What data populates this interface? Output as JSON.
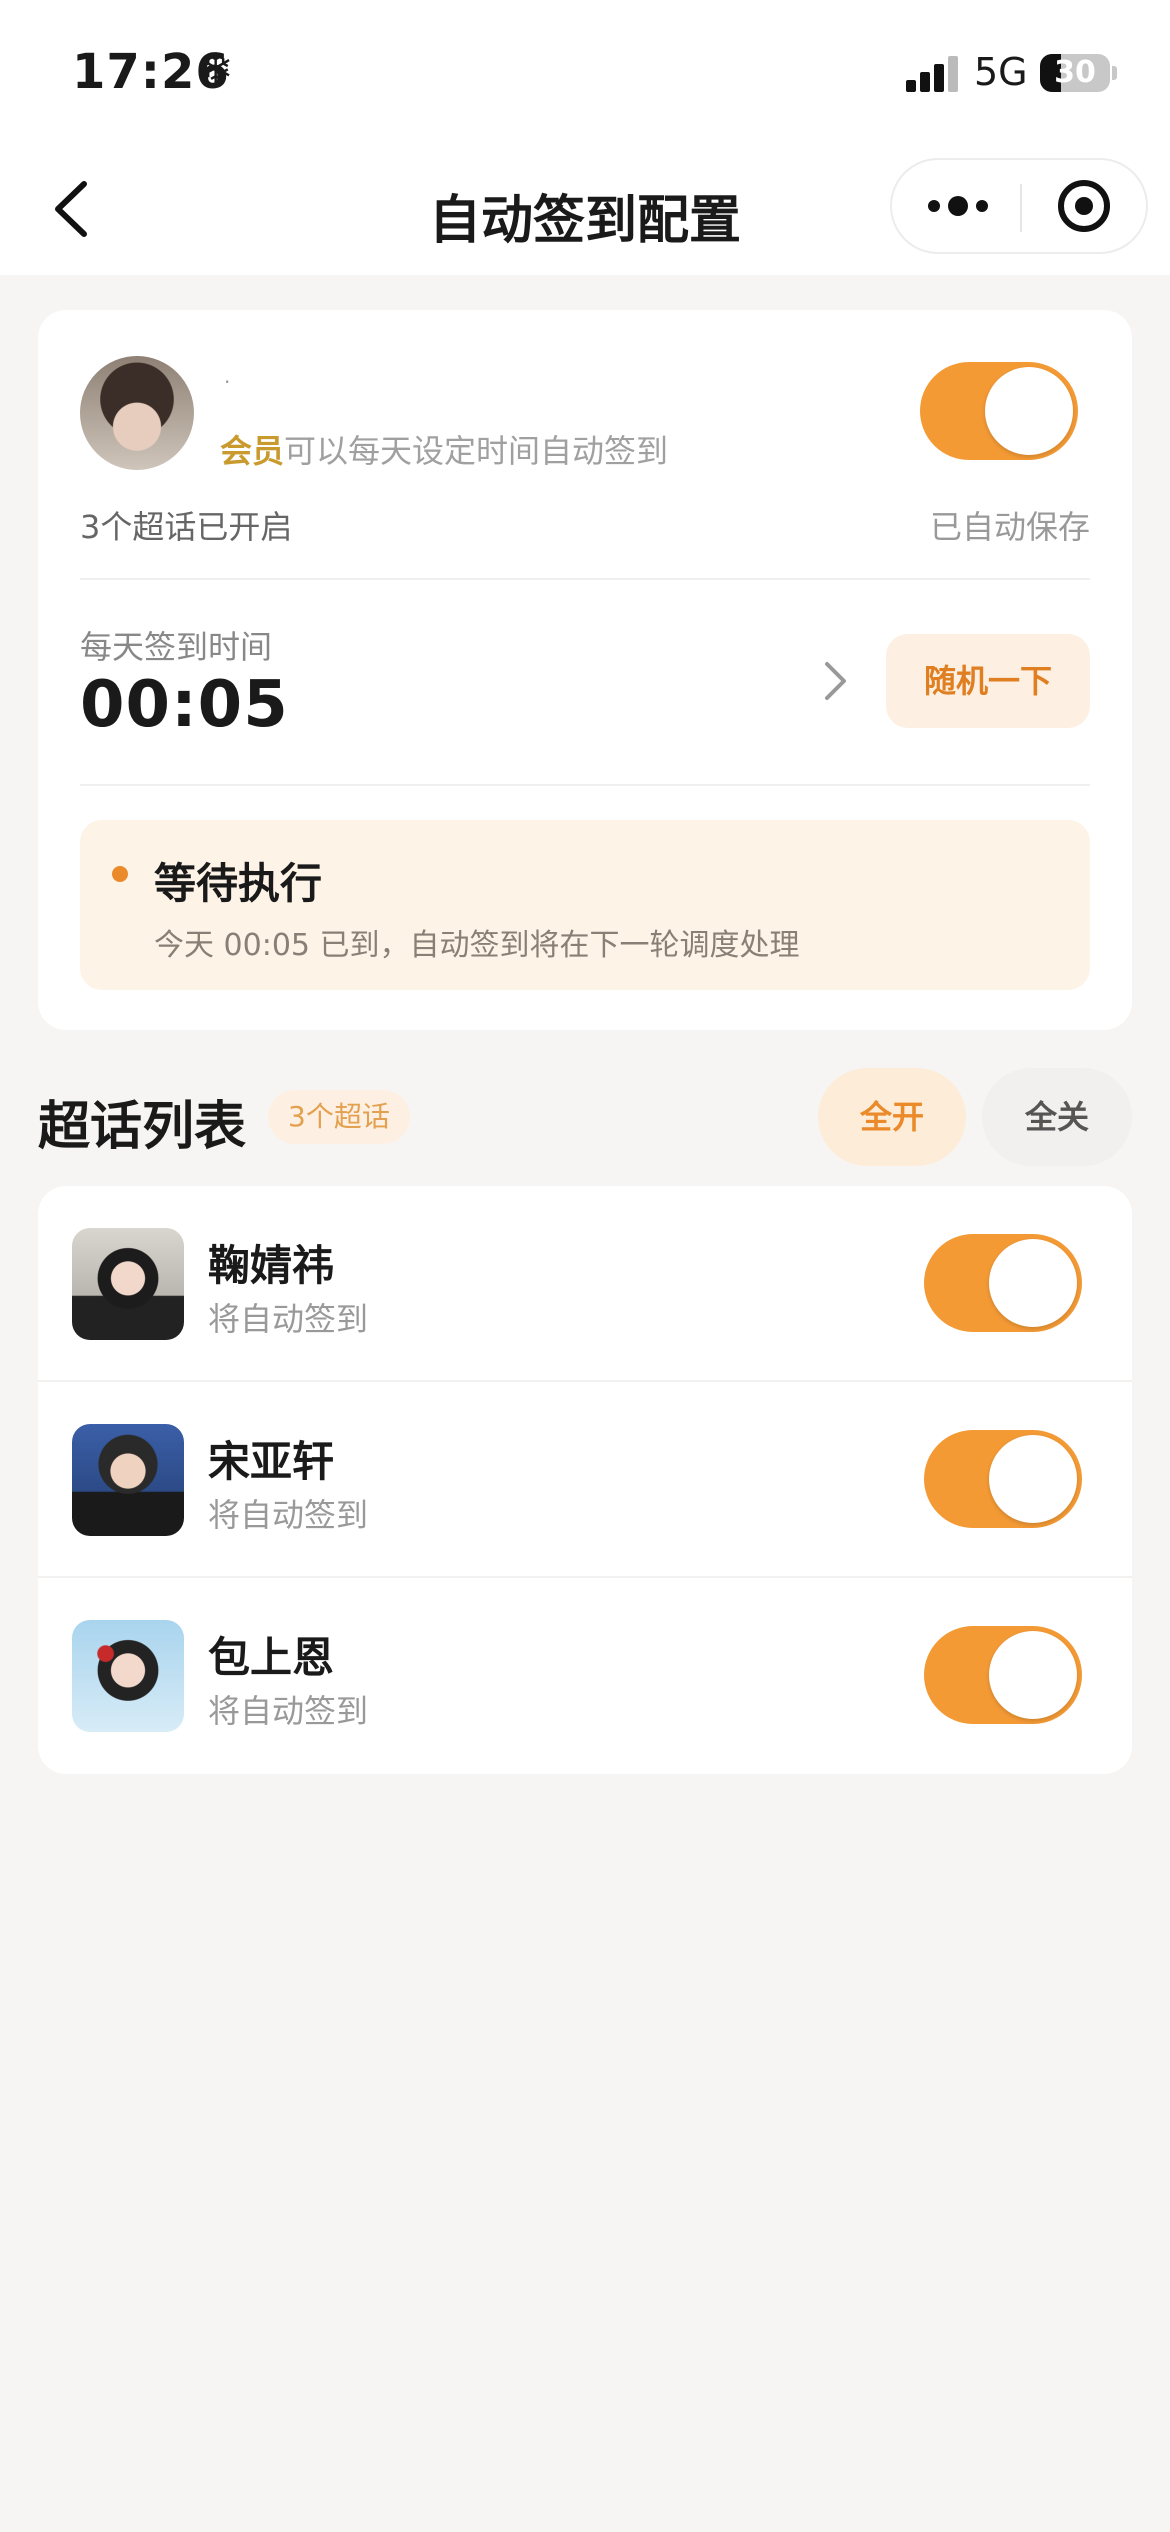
{
  "status_bar": {
    "time": "17:26",
    "extra_glyph": "❄",
    "network": "5G",
    "battery": "30",
    "battery_level": 0.3
  },
  "nav": {
    "title": "自动签到配置"
  },
  "config_card": {
    "user_name": "·",
    "member_tag": "会员",
    "member_desc": "可以每天设定时间自动签到",
    "master_switch": true,
    "open_count": "3个超话已开启",
    "autosave": "已自动保存",
    "time_label": "每天签到时间",
    "time_value": "00:05",
    "random_button": "随机一下",
    "status_title": "等待执行",
    "status_desc": "今天 00:05 已到，自动签到将在下一轮调度处理"
  },
  "list_section": {
    "title": "超话列表",
    "count_badge": "3个超话",
    "all_on": "全开",
    "all_off": "全关",
    "items": [
      {
        "name": "鞠婧祎",
        "sub": "将自动签到",
        "enabled": true
      },
      {
        "name": "宋亚轩",
        "sub": "将自动签到",
        "enabled": true
      },
      {
        "name": "包上恩",
        "sub": "将自动签到",
        "enabled": true
      }
    ]
  },
  "colors": {
    "accent": "#f39a35",
    "accent_text": "#e07f22",
    "member_gold": "#c99a2e",
    "background": "#f6f5f3"
  }
}
